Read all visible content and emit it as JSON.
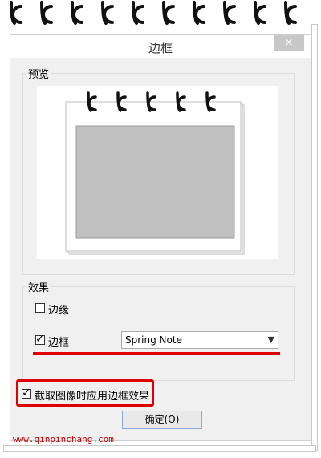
{
  "dialog": {
    "title": "边框",
    "close_label": "×"
  },
  "preview_group": {
    "label": "预览"
  },
  "effects_group": {
    "label": "效果",
    "edge_label": "边缘",
    "edge_checked": false,
    "border_label": "边框",
    "border_checked": true,
    "border_style_selected": "Spring Note"
  },
  "capture_option": {
    "label": "截取图像时应用边框效果",
    "checked": true
  },
  "ok_button": {
    "label": "确定(O)"
  },
  "watermark": {
    "text": "www.qinpinchang.com"
  },
  "icons": {
    "ring": "spiral-ring-icon",
    "check": "checkmark-icon",
    "dropdown": "chevron-down-icon",
    "close": "close-icon"
  },
  "colors": {
    "highlight": "#e00000",
    "dialog_bg": "#f0f0f0",
    "preview_fill": "#c0c0c0"
  }
}
